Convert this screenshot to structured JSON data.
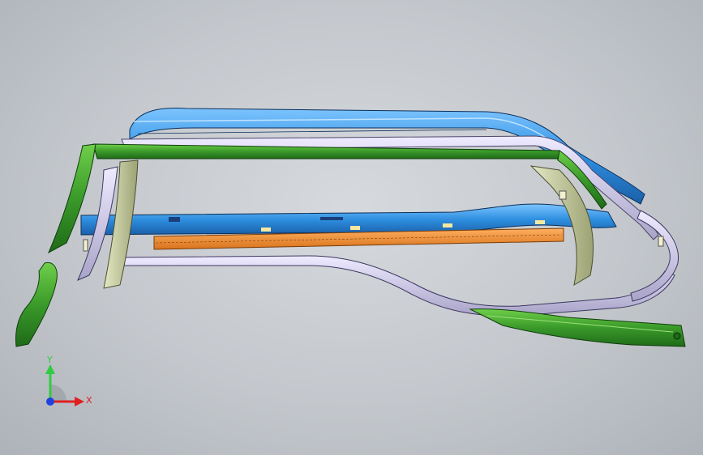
{
  "viewport": {
    "background_top": "#d6d9dd",
    "background_bottom": "#aeb3b9"
  },
  "parts": [
    {
      "name": "upper-blue-rail",
      "color": "#2f8fe0"
    },
    {
      "name": "green-roof-rail",
      "color": "#3a9a2a"
    },
    {
      "name": "lavender-roof-rail",
      "color": "#c8c4e0"
    },
    {
      "name": "mid-blue-rail",
      "color": "#2f8fe0"
    },
    {
      "name": "orange-sill-panel",
      "color": "#f0902a"
    },
    {
      "name": "lavender-lower-rail",
      "color": "#c8c4e0"
    },
    {
      "name": "front-pillar-green",
      "color": "#3a9a2a"
    },
    {
      "name": "front-pillar-olive",
      "color": "#c9cfa2"
    },
    {
      "name": "rear-pillar-olive",
      "color": "#c9cfa2"
    },
    {
      "name": "green-lower-sill",
      "color": "#3a9a2a"
    },
    {
      "name": "green-front-bracket",
      "color": "#3a9a2a"
    }
  ],
  "triad": {
    "y_label": "Y",
    "x_label": "X",
    "y_color": "#2ecc40",
    "x_color": "#e02020",
    "z_color": "#2040e0"
  }
}
